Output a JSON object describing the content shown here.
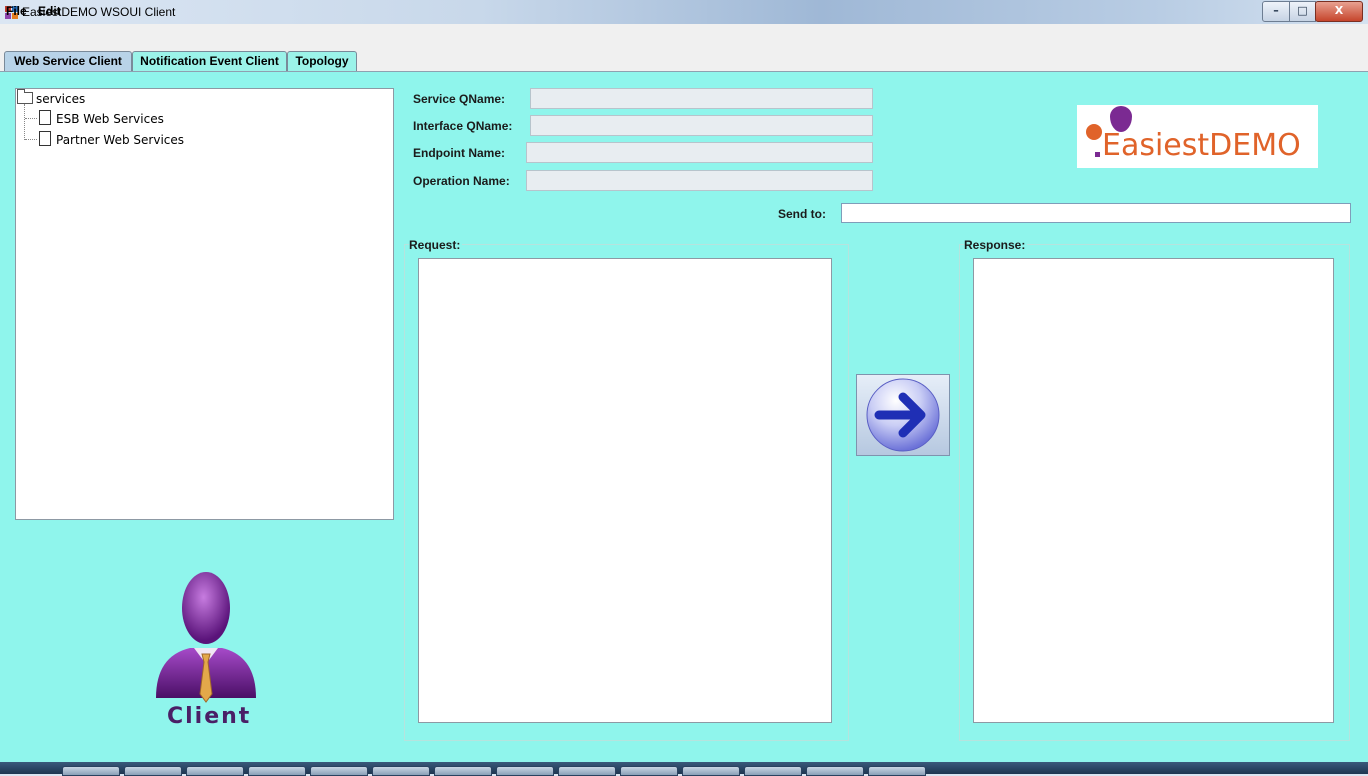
{
  "window": {
    "title": "EasiestDEMO WSOUI Client",
    "controls": {
      "minimize": "–",
      "maximize": "□",
      "close": "X"
    }
  },
  "menu": {
    "file": "File",
    "edit": "Edit"
  },
  "tabs": [
    {
      "label": "Web Service Client",
      "selected": true
    },
    {
      "label": "Notification Event Client",
      "selected": false
    },
    {
      "label": "Topology",
      "selected": false
    }
  ],
  "tree": {
    "root": "services",
    "children": [
      "ESB Web Services",
      "Partner Web Services"
    ]
  },
  "form": {
    "service_qname_label": "Service QName:",
    "interface_qname_label": "Interface QName:",
    "endpoint_name_label": "Endpoint Name:",
    "operation_name_label": "Operation Name:",
    "send_to_label": "Send to:",
    "service_qname": "",
    "interface_qname": "",
    "endpoint_name": "",
    "operation_name": "",
    "send_to": ""
  },
  "logo": {
    "text_easiest": "Easiest",
    "text_demo": "DEMO"
  },
  "request": {
    "label": "Request:",
    "content": ""
  },
  "response": {
    "label": "Response:",
    "content": ""
  },
  "client": {
    "label": "Client"
  },
  "icons": {
    "app": "app-icon",
    "send": "arrow-right-icon",
    "folder": "folder-icon",
    "document": "document-icon",
    "client": "user-icon"
  },
  "colors": {
    "content_background": "#8ff5ec",
    "tab_background": "#9bf3e9",
    "logo_orange": "#e0632a",
    "logo_purple": "#7b2a92"
  }
}
